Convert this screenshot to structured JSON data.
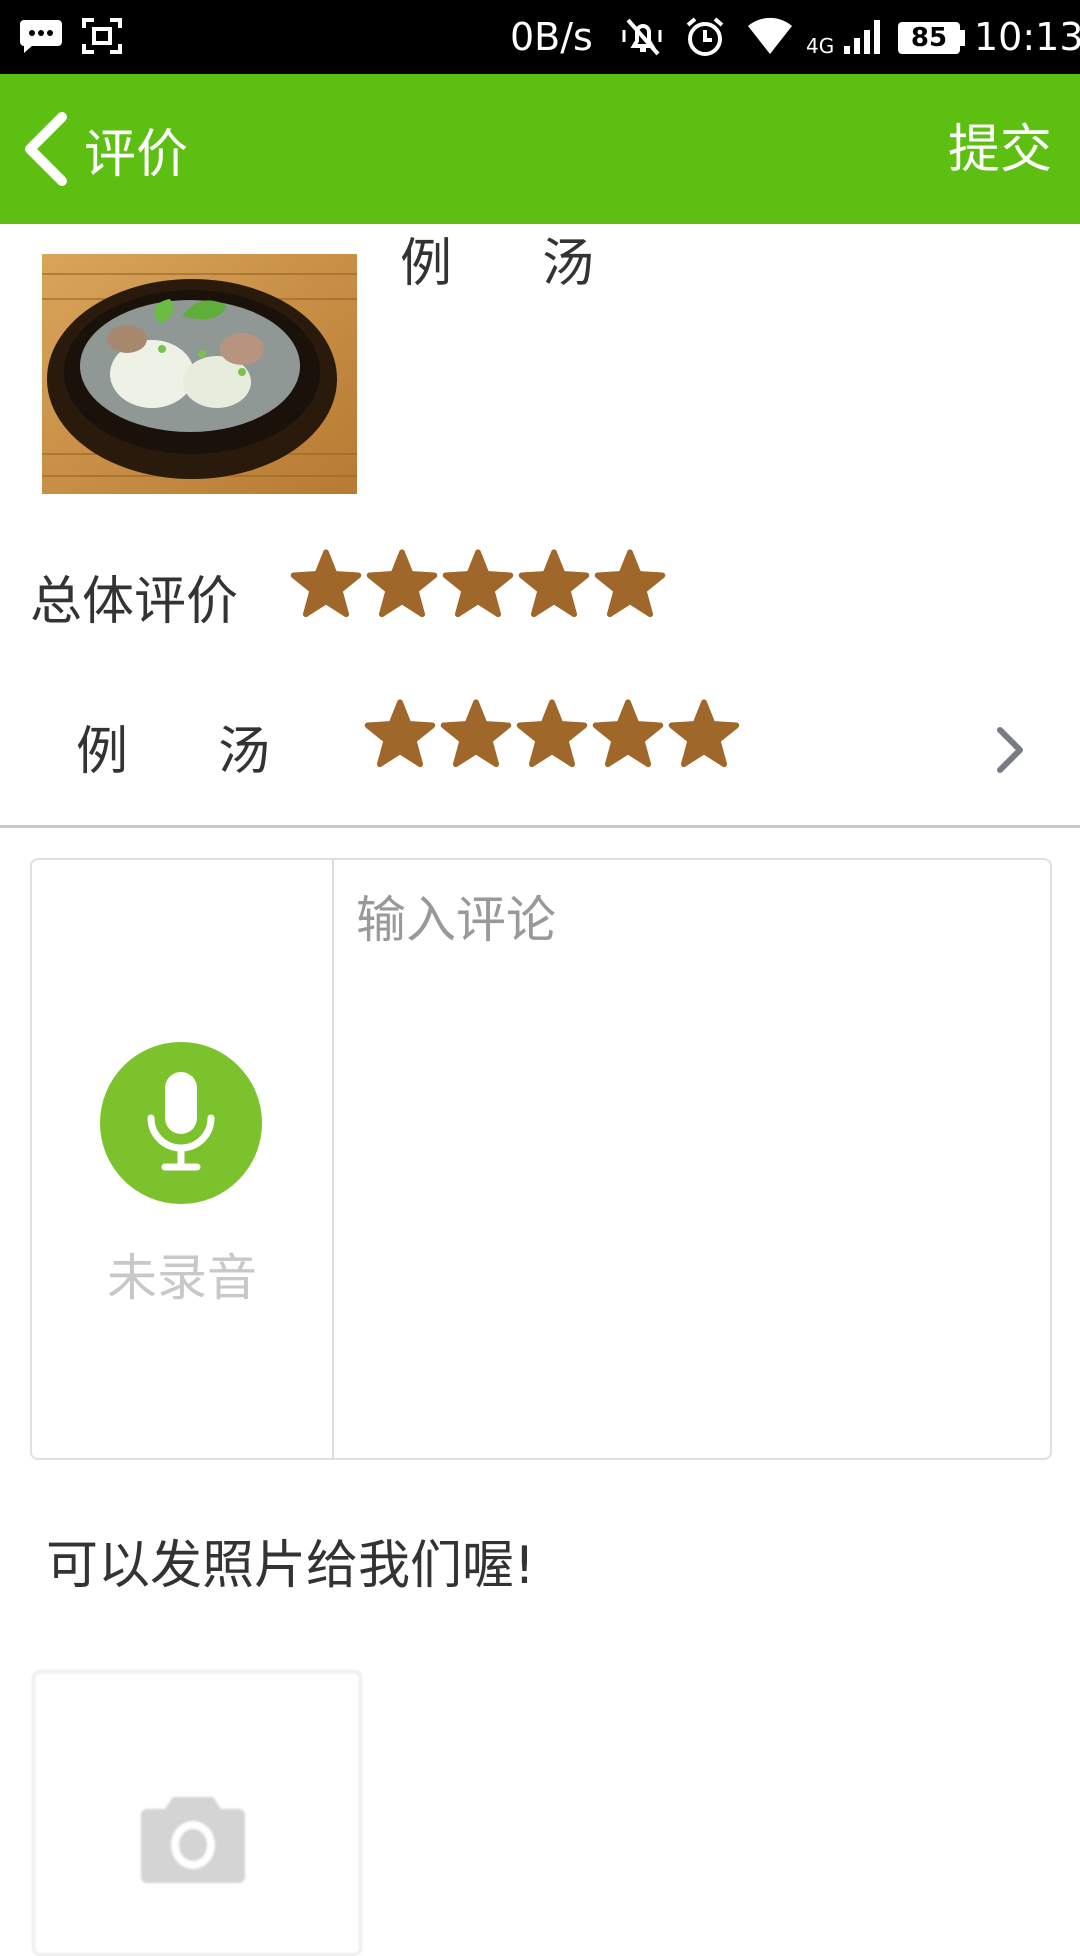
{
  "status_bar": {
    "network_speed": "0B/s",
    "network_type": "4G",
    "battery": "85",
    "time": "10:13",
    "icons": [
      "message-icon",
      "screenshot-icon",
      "mute-icon",
      "alarm-icon",
      "wifi-icon",
      "signal-icon",
      "battery-icon"
    ]
  },
  "header": {
    "title": "评价",
    "submit_label": "提交",
    "background_color": "#5cbf12"
  },
  "dish": {
    "name": "例汤"
  },
  "ratings": {
    "overall": {
      "label": "总体评价",
      "stars": 5,
      "max": 5
    },
    "item": {
      "label": "例汤",
      "stars": 5,
      "max": 5
    },
    "star_color": "#a0672a"
  },
  "comment": {
    "placeholder": "输入评论",
    "voice_status": "未录音",
    "mic_color": "#7cc22c"
  },
  "photo": {
    "hint": "可以发照片给我们喔!"
  }
}
